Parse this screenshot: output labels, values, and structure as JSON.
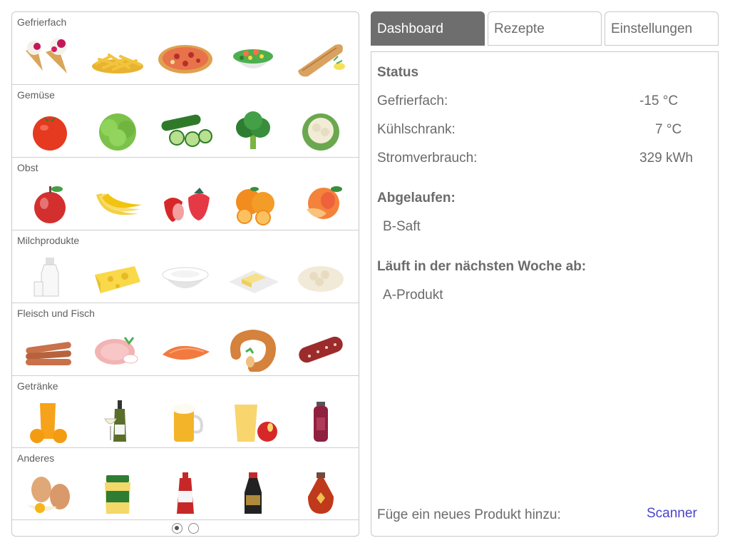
{
  "categories": [
    {
      "title": "Gefrierfach",
      "items": [
        "ice-cream-cone",
        "french-fries",
        "pizza",
        "frozen-vegetables",
        "fish-fillet"
      ]
    },
    {
      "title": "Gemüse",
      "items": [
        "tomato",
        "lettuce",
        "cucumber",
        "broccoli",
        "cauliflower"
      ]
    },
    {
      "title": "Obst",
      "items": [
        "apple",
        "bananas",
        "strawberries",
        "oranges",
        "peach"
      ]
    },
    {
      "title": "Milchprodukte",
      "items": [
        "milk-bottle",
        "cheese",
        "yogurt",
        "butter",
        "cottage-cheese"
      ]
    },
    {
      "title": "Fleisch und Fisch",
      "items": [
        "sausages",
        "ham",
        "salmon",
        "ring-sausage",
        "salami"
      ]
    },
    {
      "title": "Getränke",
      "items": [
        "orange-juice",
        "wine",
        "beer",
        "apple-juice",
        "smoothie-bottle"
      ]
    },
    {
      "title": "Anderes",
      "items": [
        "eggs",
        "mustard-jar",
        "ketchup",
        "soy-sauce",
        "maple-syrup"
      ]
    }
  ],
  "pager": {
    "pages": 2,
    "current": 1
  },
  "tabs": {
    "dashboard": "Dashboard",
    "rezepte": "Rezepte",
    "einstellungen": "Einstellungen"
  },
  "status": {
    "heading": "Status",
    "freezer_label": "Gefrierfach:",
    "freezer_value": "-15 °C",
    "fridge_label": "Kühlschrank:",
    "fridge_value": "7 °C",
    "power_label": "Stromverbrauch:",
    "power_value": "329 kWh"
  },
  "expired": {
    "heading": "Abgelaufen:",
    "items": [
      "B-Saft"
    ]
  },
  "expiring": {
    "heading": "Läuft in der nächsten Woche ab:",
    "items": [
      "A-Produkt"
    ]
  },
  "add_product": {
    "label": "Füge ein neues Produkt hinzu:",
    "scanner_label": "Scanner"
  },
  "colors": {
    "active_tab": "#6e6e6e",
    "link": "#4a44c8"
  }
}
